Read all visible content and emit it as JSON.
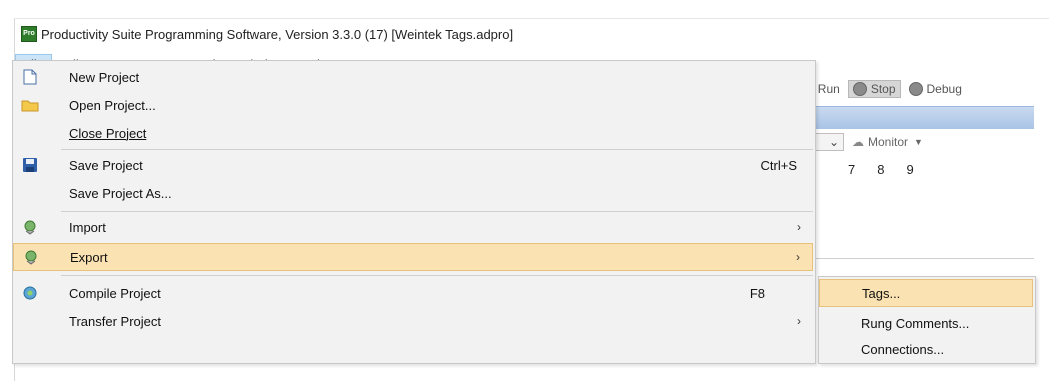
{
  "window": {
    "logo_text": "Pro",
    "title": "Productivity Suite Programming Software, Version 3.3.0 (17)   [Weintek Tags.adpro]"
  },
  "menubar": {
    "items": [
      {
        "label": "File",
        "active": true
      },
      {
        "label": "Edit"
      },
      {
        "label": "Setup"
      },
      {
        "label": "CPU"
      },
      {
        "label": "Tools"
      },
      {
        "label": "Window"
      },
      {
        "label": "Help"
      }
    ]
  },
  "toolbar_bg": {
    "partial": "U",
    "run": "Run",
    "stop": "Stop",
    "debug": "Debug",
    "combo_partial": "n",
    "monitor": "Monitor",
    "numbers": [
      "7",
      "8",
      "9"
    ]
  },
  "file_menu": {
    "items": [
      {
        "label": "New Project",
        "icon": "new-project-icon"
      },
      {
        "label": "Open Project...",
        "icon": "folder-open-icon"
      },
      {
        "label": "Close Project"
      },
      {
        "label": "Save Project",
        "shortcut": "Ctrl+S",
        "icon": "floppy-disk-icon"
      },
      {
        "label": "Save Project As..."
      },
      {
        "label": "Import",
        "submenu": true,
        "icon": "import-icon"
      },
      {
        "label": "Export",
        "submenu": true,
        "highlighted": true,
        "icon": "export-icon"
      },
      {
        "label": "Compile Project",
        "shortcut": "F8",
        "icon": "compile-icon"
      },
      {
        "label": "Transfer Project",
        "submenu": true
      }
    ],
    "submenu_arrow": "›"
  },
  "export_submenu": {
    "items": [
      {
        "label": "Tags...",
        "highlighted": true
      },
      {
        "label": "Rung Comments..."
      },
      {
        "label": "Connections..."
      }
    ]
  },
  "colors": {
    "highlight": "#fbe2b3",
    "menu_bg": "#f2f2f2",
    "logo_green": "#2f7d2b"
  }
}
